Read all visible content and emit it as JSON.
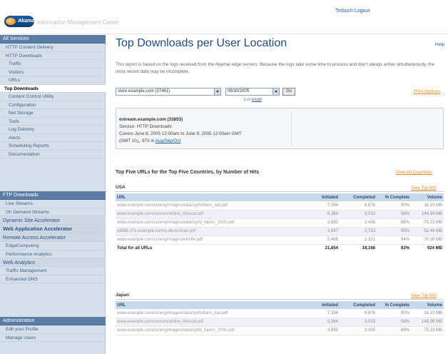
{
  "header": {
    "logo_text": "Akamai",
    "product_name": "Information Management Center",
    "user_link": "Torbuch Logout"
  },
  "sidebar": {
    "groups": [
      {
        "head": "All Services",
        "items": [
          {
            "label": "HTTP Content Delivery",
            "style": ""
          },
          {
            "label": "HTTP Downloads",
            "style": ""
          },
          {
            "label": "Traffic",
            "style": "sub"
          },
          {
            "label": "Visitors",
            "style": "sub"
          },
          {
            "label": "URLs",
            "style": "sub"
          },
          {
            "label": "Top Downloads",
            "style": "active"
          },
          {
            "label": "Content Control Utility",
            "style": "sub"
          },
          {
            "label": "Configuration",
            "style": "sub"
          },
          {
            "label": "Net Storage",
            "style": "sub"
          },
          {
            "label": "Tools",
            "style": "sub"
          },
          {
            "label": "Log Delivery",
            "style": "sub"
          },
          {
            "label": "Alerts",
            "style": "sub"
          },
          {
            "label": "Scheduling Reports",
            "style": "sub"
          },
          {
            "label": "Documentation",
            "style": "sub"
          }
        ]
      },
      {
        "head": "FTP Downloads",
        "items": [
          {
            "label": "Live Streams",
            "style": ""
          },
          {
            "label": "On Demand Streams",
            "style": ""
          },
          {
            "label": "Dynamic Site Accelerator",
            "style": "big"
          },
          {
            "label": "Web Application Accelerator",
            "style": "big bold"
          },
          {
            "label": "Remote Access Accelerator",
            "style": "big"
          },
          {
            "label": "EdgeComputing",
            "style": ""
          },
          {
            "label": "Performance Analytics",
            "style": ""
          },
          {
            "label": "Web Analytics",
            "style": "big"
          },
          {
            "label": "Traffic Management",
            "style": ""
          },
          {
            "label": "Enhanced DNS",
            "style": ""
          }
        ]
      },
      {
        "head": "Administration",
        "items": [
          {
            "label": "Edit your Profile",
            "style": ""
          },
          {
            "label": "Manage Users",
            "style": ""
          }
        ]
      }
    ]
  },
  "main": {
    "title": "Top Downloads per User Location",
    "help_link": "Help",
    "intro": "This report is based on the logs received from the Akamai edge servers. Because the logs take some time to process and don't always arrive simultaneously, the most recent data may be incomplete.",
    "cpcode_select": "store.example.com (37461)",
    "date_select": "06/30/2005",
    "go_label": "Go",
    "select_hint_prefix": "Edit",
    "select_hint_link": "Email",
    "print_link": "Print Options",
    "info": {
      "line1": "estream.example.com (33853)",
      "line2": "Service: HTTP Downloads",
      "line3": "Covers June 8, 2005 12:00am to June 9, 2005 12:00am GMT",
      "line4_prefix": "(GMT 10¿, 973 in ",
      "line4_link": "Aug/Sep/Oct"
    },
    "section_title": "Top Five URLs for the Top Five Countries, by Number of Hits",
    "section_link": "View All Countries",
    "columns": [
      "URL",
      "Initiated",
      "Completed",
      "% Complete",
      "Volume"
    ],
    "countries": [
      {
        "name": "USA",
        "link": "View Top 500",
        "rows": [
          {
            "url": "www.example.com/us/eng/images/data/cyrfortions_bat.pdf",
            "initiated": "7,384",
            "completed": "6,676",
            "pct": "90%",
            "volume": "16.10 MB"
          },
          {
            "url": "www.example.com/us/com/online_thissud.pdf",
            "initiated": "5,364",
            "completed": "3,013",
            "pct": "56%",
            "volume": "149.39 MB"
          },
          {
            "url": "www.example.com/us/eng/images/data/cyrfd_topics_2001.pdf",
            "initiated": "3,893",
            "completed": "3,435",
            "pct": "88%",
            "volume": "75.23 MB"
          },
          {
            "url": "eBBB-ATk.example.com/u.dkvoc/loan.pdf",
            "initiated": "2,847",
            "completed": "2,713",
            "pct": "95%",
            "volume": "52.49 MB"
          },
          {
            "url": "www.example.com/us/eng/images/info/lfe.pdf",
            "initiated": "2,468",
            "completed": "2,321",
            "pct": "94%",
            "volume": "70.38 MB"
          }
        ],
        "total": {
          "url": "Total for all URLs",
          "initiated": "21,854",
          "completed": "18,168",
          "pct": "83%",
          "volume": "924 MB"
        }
      },
      {
        "name": "Japan",
        "link": "View Top 500",
        "rows": [
          {
            "url": "www.example.com/us/eng/images/data/cyrfortions_bat.pdf",
            "initiated": "7,384",
            "completed": "6,676",
            "pct": "90%",
            "volume": "16.10 MB"
          },
          {
            "url": "www.example.com/us/com/online_thissud.pdf",
            "initiated": "5,364",
            "completed": "3,013",
            "pct": "56%",
            "volume": "149.39 MB"
          },
          {
            "url": "www.example.com/us/eng/images/data/cyrfd_topics_2001.pdf",
            "initiated": "3,893",
            "completed": "3,435",
            "pct": "88%",
            "volume": "75.23 MB"
          }
        ]
      }
    ]
  }
}
